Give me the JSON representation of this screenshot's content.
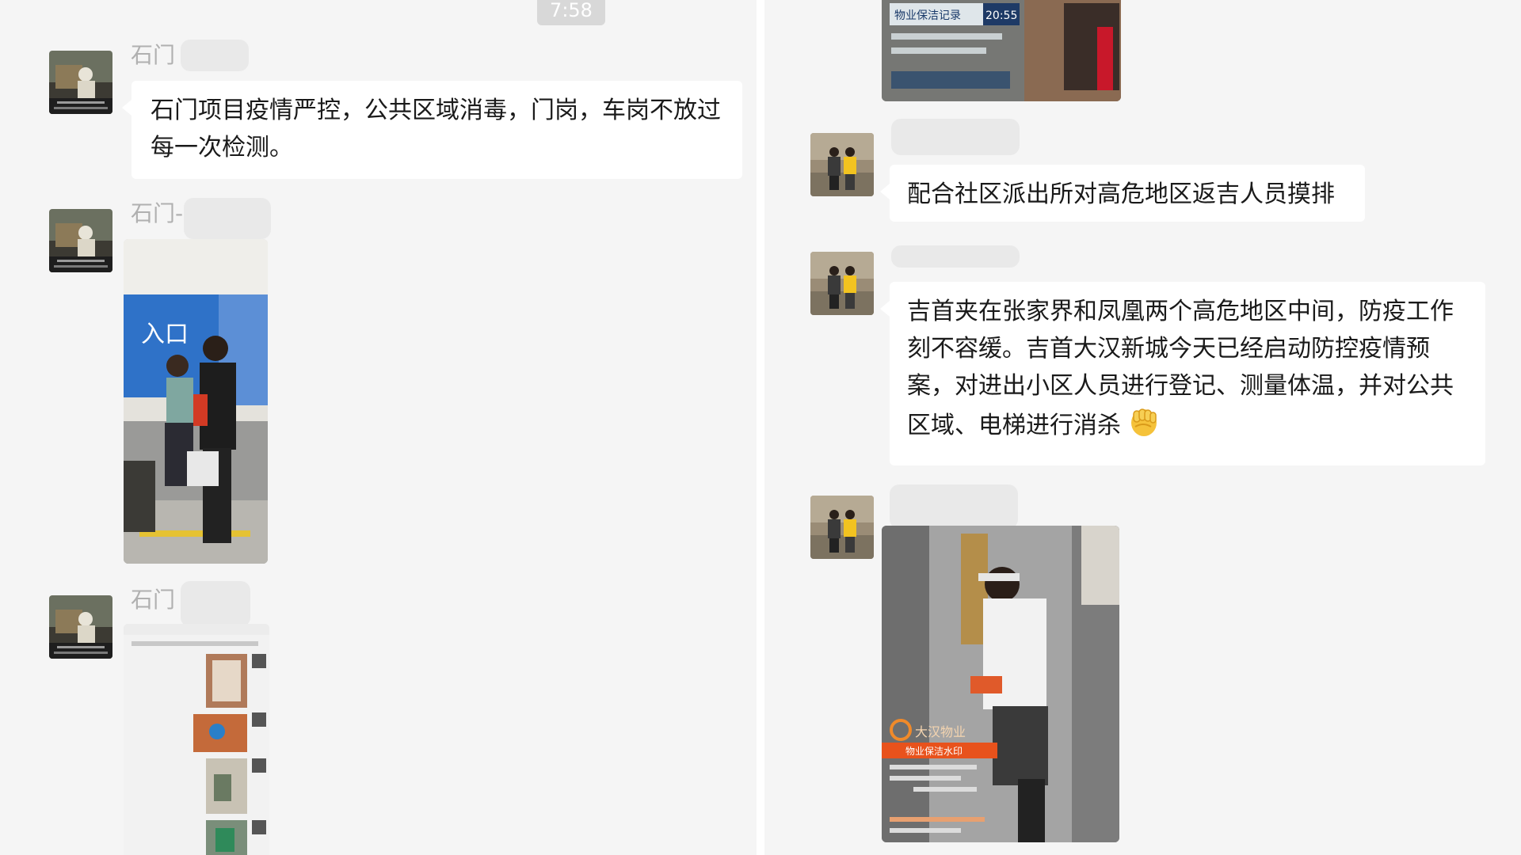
{
  "timestamp": "7:58",
  "left_chat": {
    "messages": [
      {
        "sender": "石门",
        "text": "石门项目疫情严控，公共区域消毒，门岗，车岗不放过每一次检测。"
      },
      {
        "sender": "石门-",
        "image_text": "入口"
      },
      {
        "sender": "石门"
      }
    ]
  },
  "right_chat": {
    "top_card": {
      "title": "物业保洁记录",
      "time": "20:55"
    },
    "messages": [
      {
        "text": "配合社区派出所对高危地区返吉人员摸排"
      },
      {
        "text": "吉首夹在张家界和凤凰两个高危地区中间，防疫工作刻不容缓。吉首大汉新城今天已经启动防控疫情预案，对进出小区人员进行登记、测量体温，并对公共区域、电梯进行消杀",
        "emoji": "fist-icon"
      },
      {
        "image_brand": "大汉物业",
        "image_banner": "物业保洁水印"
      }
    ]
  },
  "colors": {
    "panel_bg": "#f5f5f5",
    "bubble_bg": "#ffffff",
    "accent_blue": "#2f72c8",
    "banner_orange": "#e8521c"
  }
}
